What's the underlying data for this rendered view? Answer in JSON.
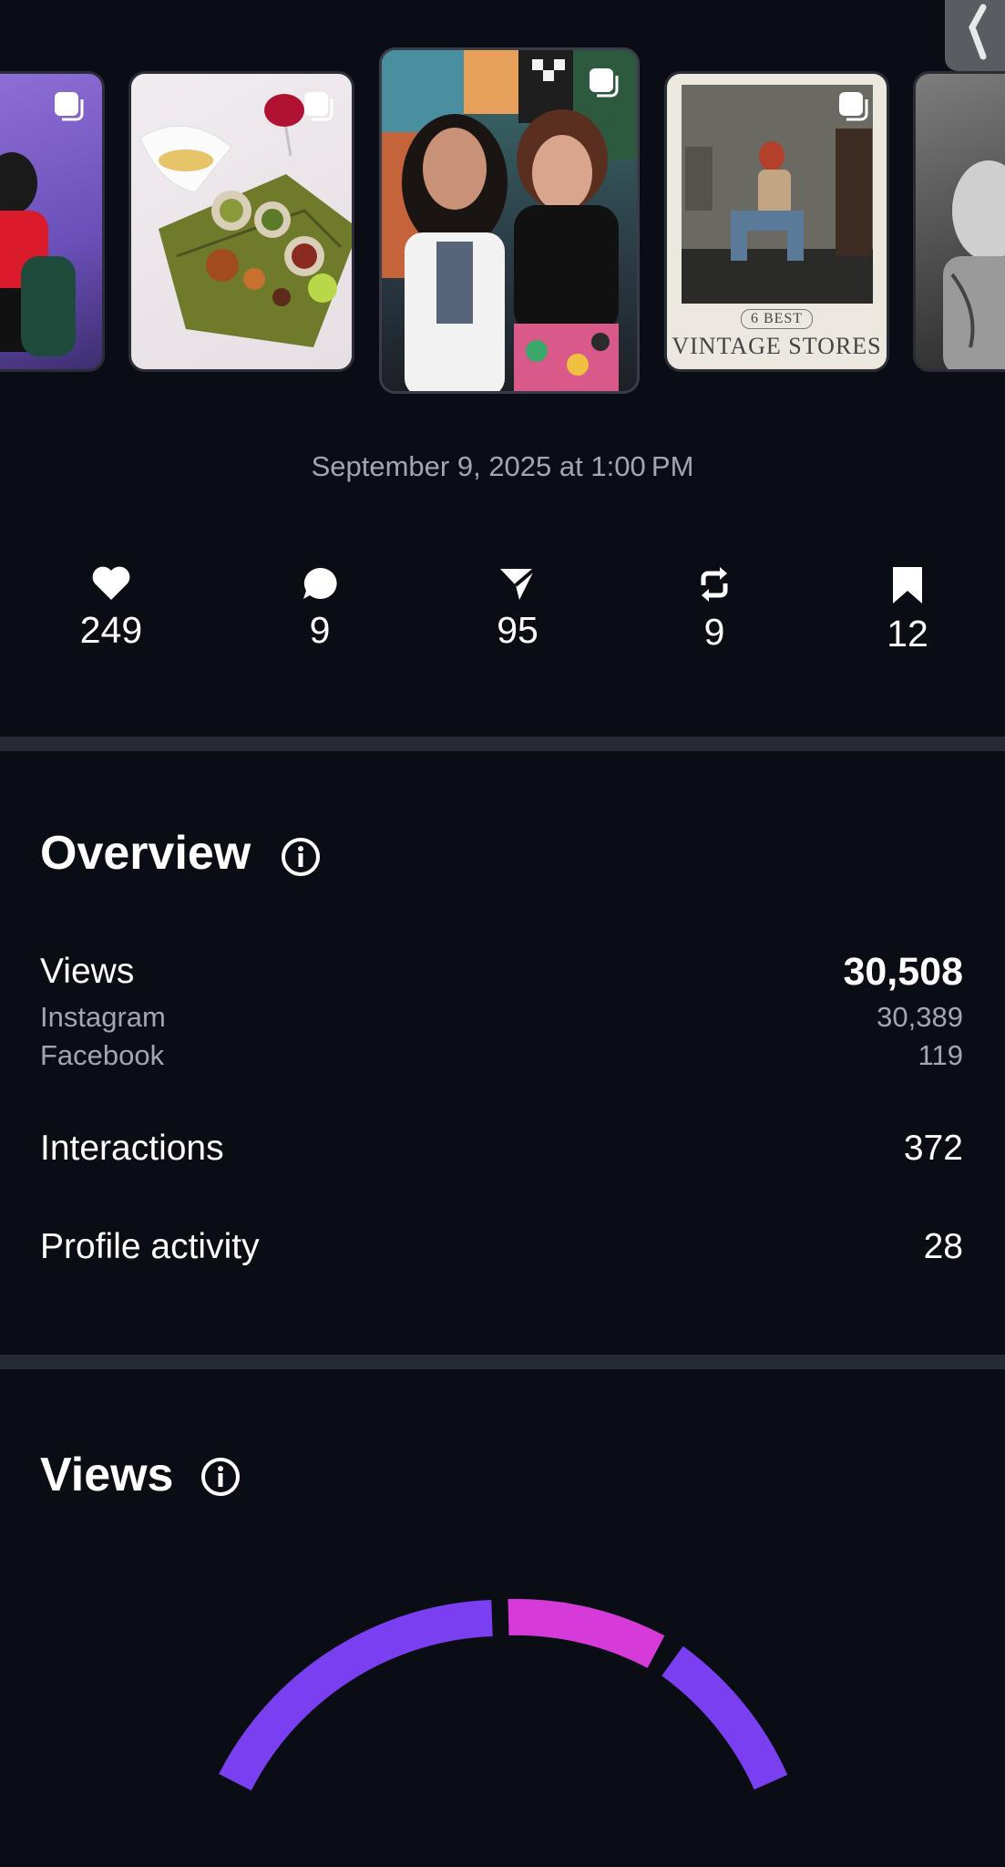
{
  "carousel": {
    "thumb4_caption_small": "6 BEST",
    "thumb4_caption_large": "VINTAGE STORES"
  },
  "post": {
    "date": "September 9, 2025 at 1:00 PM"
  },
  "stats": {
    "likes": "249",
    "comments": "9",
    "shares": "95",
    "reposts": "9",
    "saves": "12"
  },
  "overview": {
    "title": "Overview",
    "views_label": "Views",
    "views_value": "30,508",
    "instagram_label": "Instagram",
    "instagram_value": "30,389",
    "facebook_label": "Facebook",
    "facebook_value": "119",
    "interactions_label": "Interactions",
    "interactions_value": "372",
    "profile_activity_label": "Profile activity",
    "profile_activity_value": "28"
  },
  "views_section": {
    "title": "Views"
  },
  "colors": {
    "background": "#0b0d14",
    "divider": "#262a34",
    "muted_text": "#a3a6b0",
    "gauge_purple": "#7b3ff2",
    "gauge_magenta": "#d63ad8"
  },
  "icons": [
    "heart-icon",
    "comment-icon",
    "share-icon",
    "repost-icon",
    "bookmark-icon",
    "info-icon",
    "multi-photo-icon",
    "back-chevron-icon"
  ]
}
